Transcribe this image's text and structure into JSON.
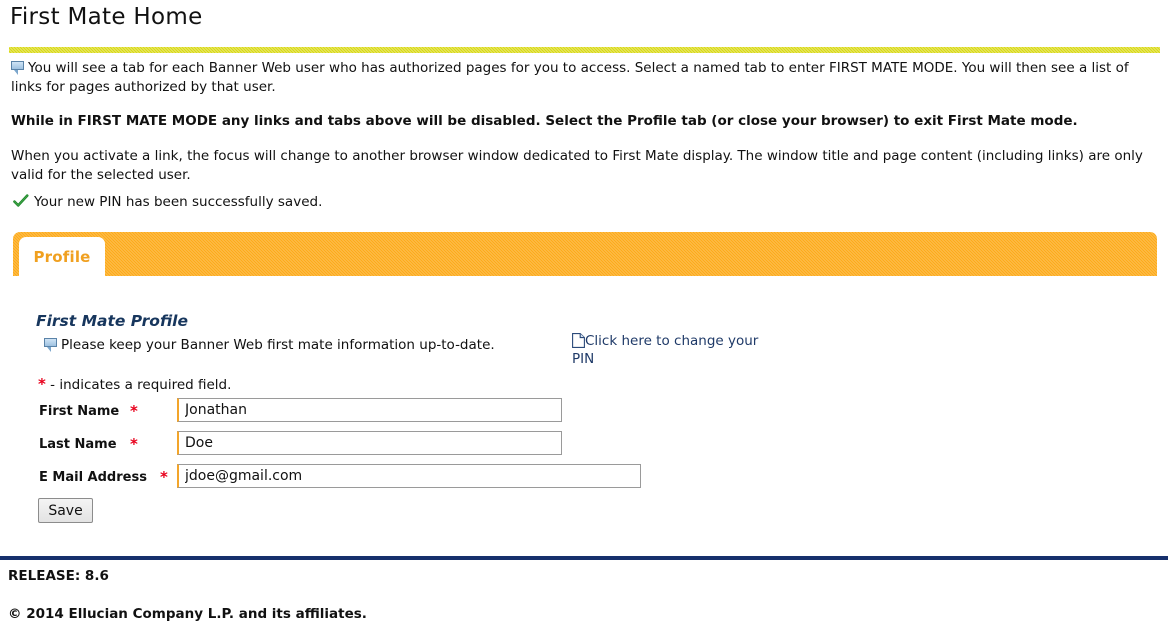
{
  "page": {
    "title": "First Mate Home"
  },
  "colors": {
    "rule_yellow": "#d9d916",
    "tab_orange": "#fcab1b",
    "tab_label": "#f0a020",
    "section_navy": "#17365d",
    "footer_navy": "#16306c",
    "required_red": "#e8001c",
    "link_navy": "#1f3a68",
    "success_green": "#1e8a2a"
  },
  "intro": {
    "bubble_icon": "speech-bubble-icon",
    "paragraph1": "You will see a tab for each Banner Web user who has authorized pages for you to access. Select a named tab to enter FIRST MATE MODE. You will then see a list of links for pages authorized by that user.",
    "paragraph2": "While in FIRST MATE MODE any links and tabs above will be disabled. Select the Profile tab (or close your browser) to exit First Mate mode.",
    "paragraph3": "When you activate a link, the focus will change to another browser window dedicated to First Mate display. The window title and page content (including links) are only valid for the selected user."
  },
  "success": {
    "icon": "green-check-icon",
    "message": "Your new PIN has been successfully saved."
  },
  "tabs": [
    {
      "label": "Profile",
      "active": true
    }
  ],
  "profile": {
    "section_title": "First Mate Profile",
    "note_icon": "speech-bubble-icon",
    "note": "Please keep your Banner Web first mate information up-to-date.",
    "pin_link_icon": "document-icon",
    "pin_link_text": "Click here to change your PIN",
    "required_star": "*",
    "required_note": "- indicates a required field.",
    "fields": [
      {
        "label": "First Name",
        "required": "*",
        "value": "Jonathan",
        "placeholder": ""
      },
      {
        "label": "Last Name",
        "required": "*",
        "value": "Doe",
        "placeholder": ""
      },
      {
        "label": "E Mail Address",
        "required": "*",
        "value": "jdoe@gmail.com",
        "placeholder": ""
      }
    ],
    "save_label": "Save"
  },
  "footer": {
    "release": "RELEASE: 8.6",
    "copyright": "© 2014 Ellucian Company L.P. and its affiliates."
  }
}
